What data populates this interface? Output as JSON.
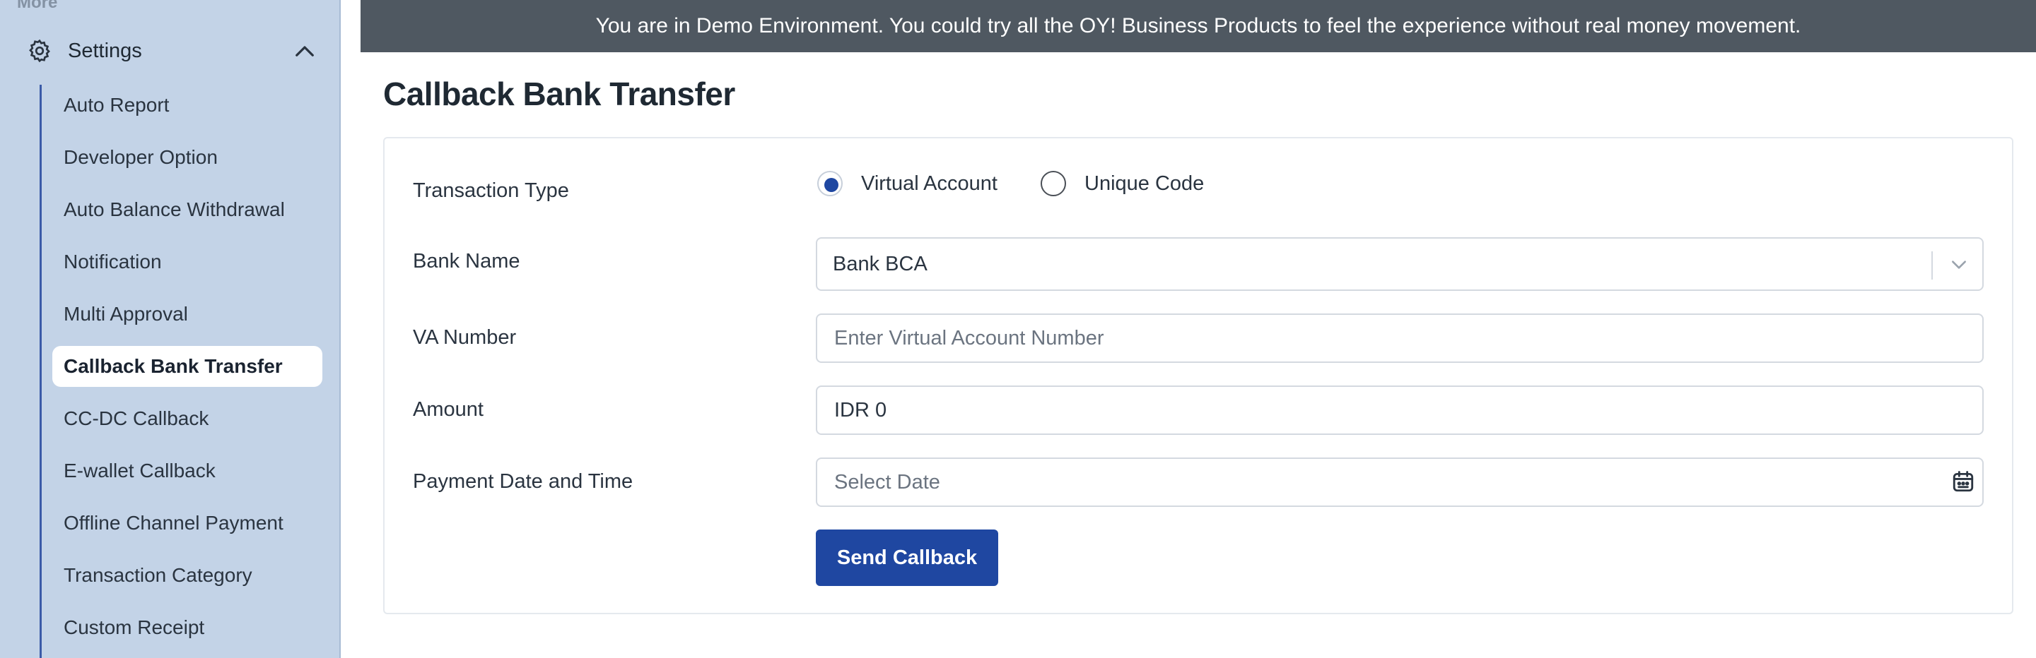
{
  "sidebar": {
    "more_label": "More",
    "settings_label": "Settings",
    "items": [
      {
        "label": "Auto Report"
      },
      {
        "label": "Developer Option"
      },
      {
        "label": "Auto Balance Withdrawal"
      },
      {
        "label": "Notification"
      },
      {
        "label": "Multi Approval"
      },
      {
        "label": "Callback Bank Transfer",
        "active": true
      },
      {
        "label": "CC-DC Callback"
      },
      {
        "label": "E-wallet Callback"
      },
      {
        "label": "Offline Channel Payment"
      },
      {
        "label": "Transaction Category"
      },
      {
        "label": "Custom Receipt"
      }
    ]
  },
  "banner": {
    "text": "You are in Demo Environment. You could try all the OY! Business Products to feel the experience without real money movement."
  },
  "page": {
    "title": "Callback Bank Transfer"
  },
  "form": {
    "transaction_type": {
      "label": "Transaction Type",
      "options": [
        "Virtual Account",
        "Unique Code"
      ],
      "selected": "Virtual Account"
    },
    "bank_name": {
      "label": "Bank Name",
      "value": "Bank BCA"
    },
    "va_number": {
      "label": "VA Number",
      "value": "",
      "placeholder": "Enter Virtual Account Number"
    },
    "amount": {
      "label": "Amount",
      "value": "IDR 0"
    },
    "payment_date": {
      "label": "Payment Date and Time",
      "value": "",
      "placeholder": "Select Date"
    },
    "submit_label": "Send Callback"
  },
  "colors": {
    "sidebar_bg": "#c3d3e7",
    "banner_bg": "#4f5861",
    "primary": "#1f47a1"
  },
  "icons": {
    "settings": "gear-icon",
    "collapse": "chevron-up-icon",
    "dropdown": "chevron-down-icon",
    "date": "calendar-icon"
  }
}
